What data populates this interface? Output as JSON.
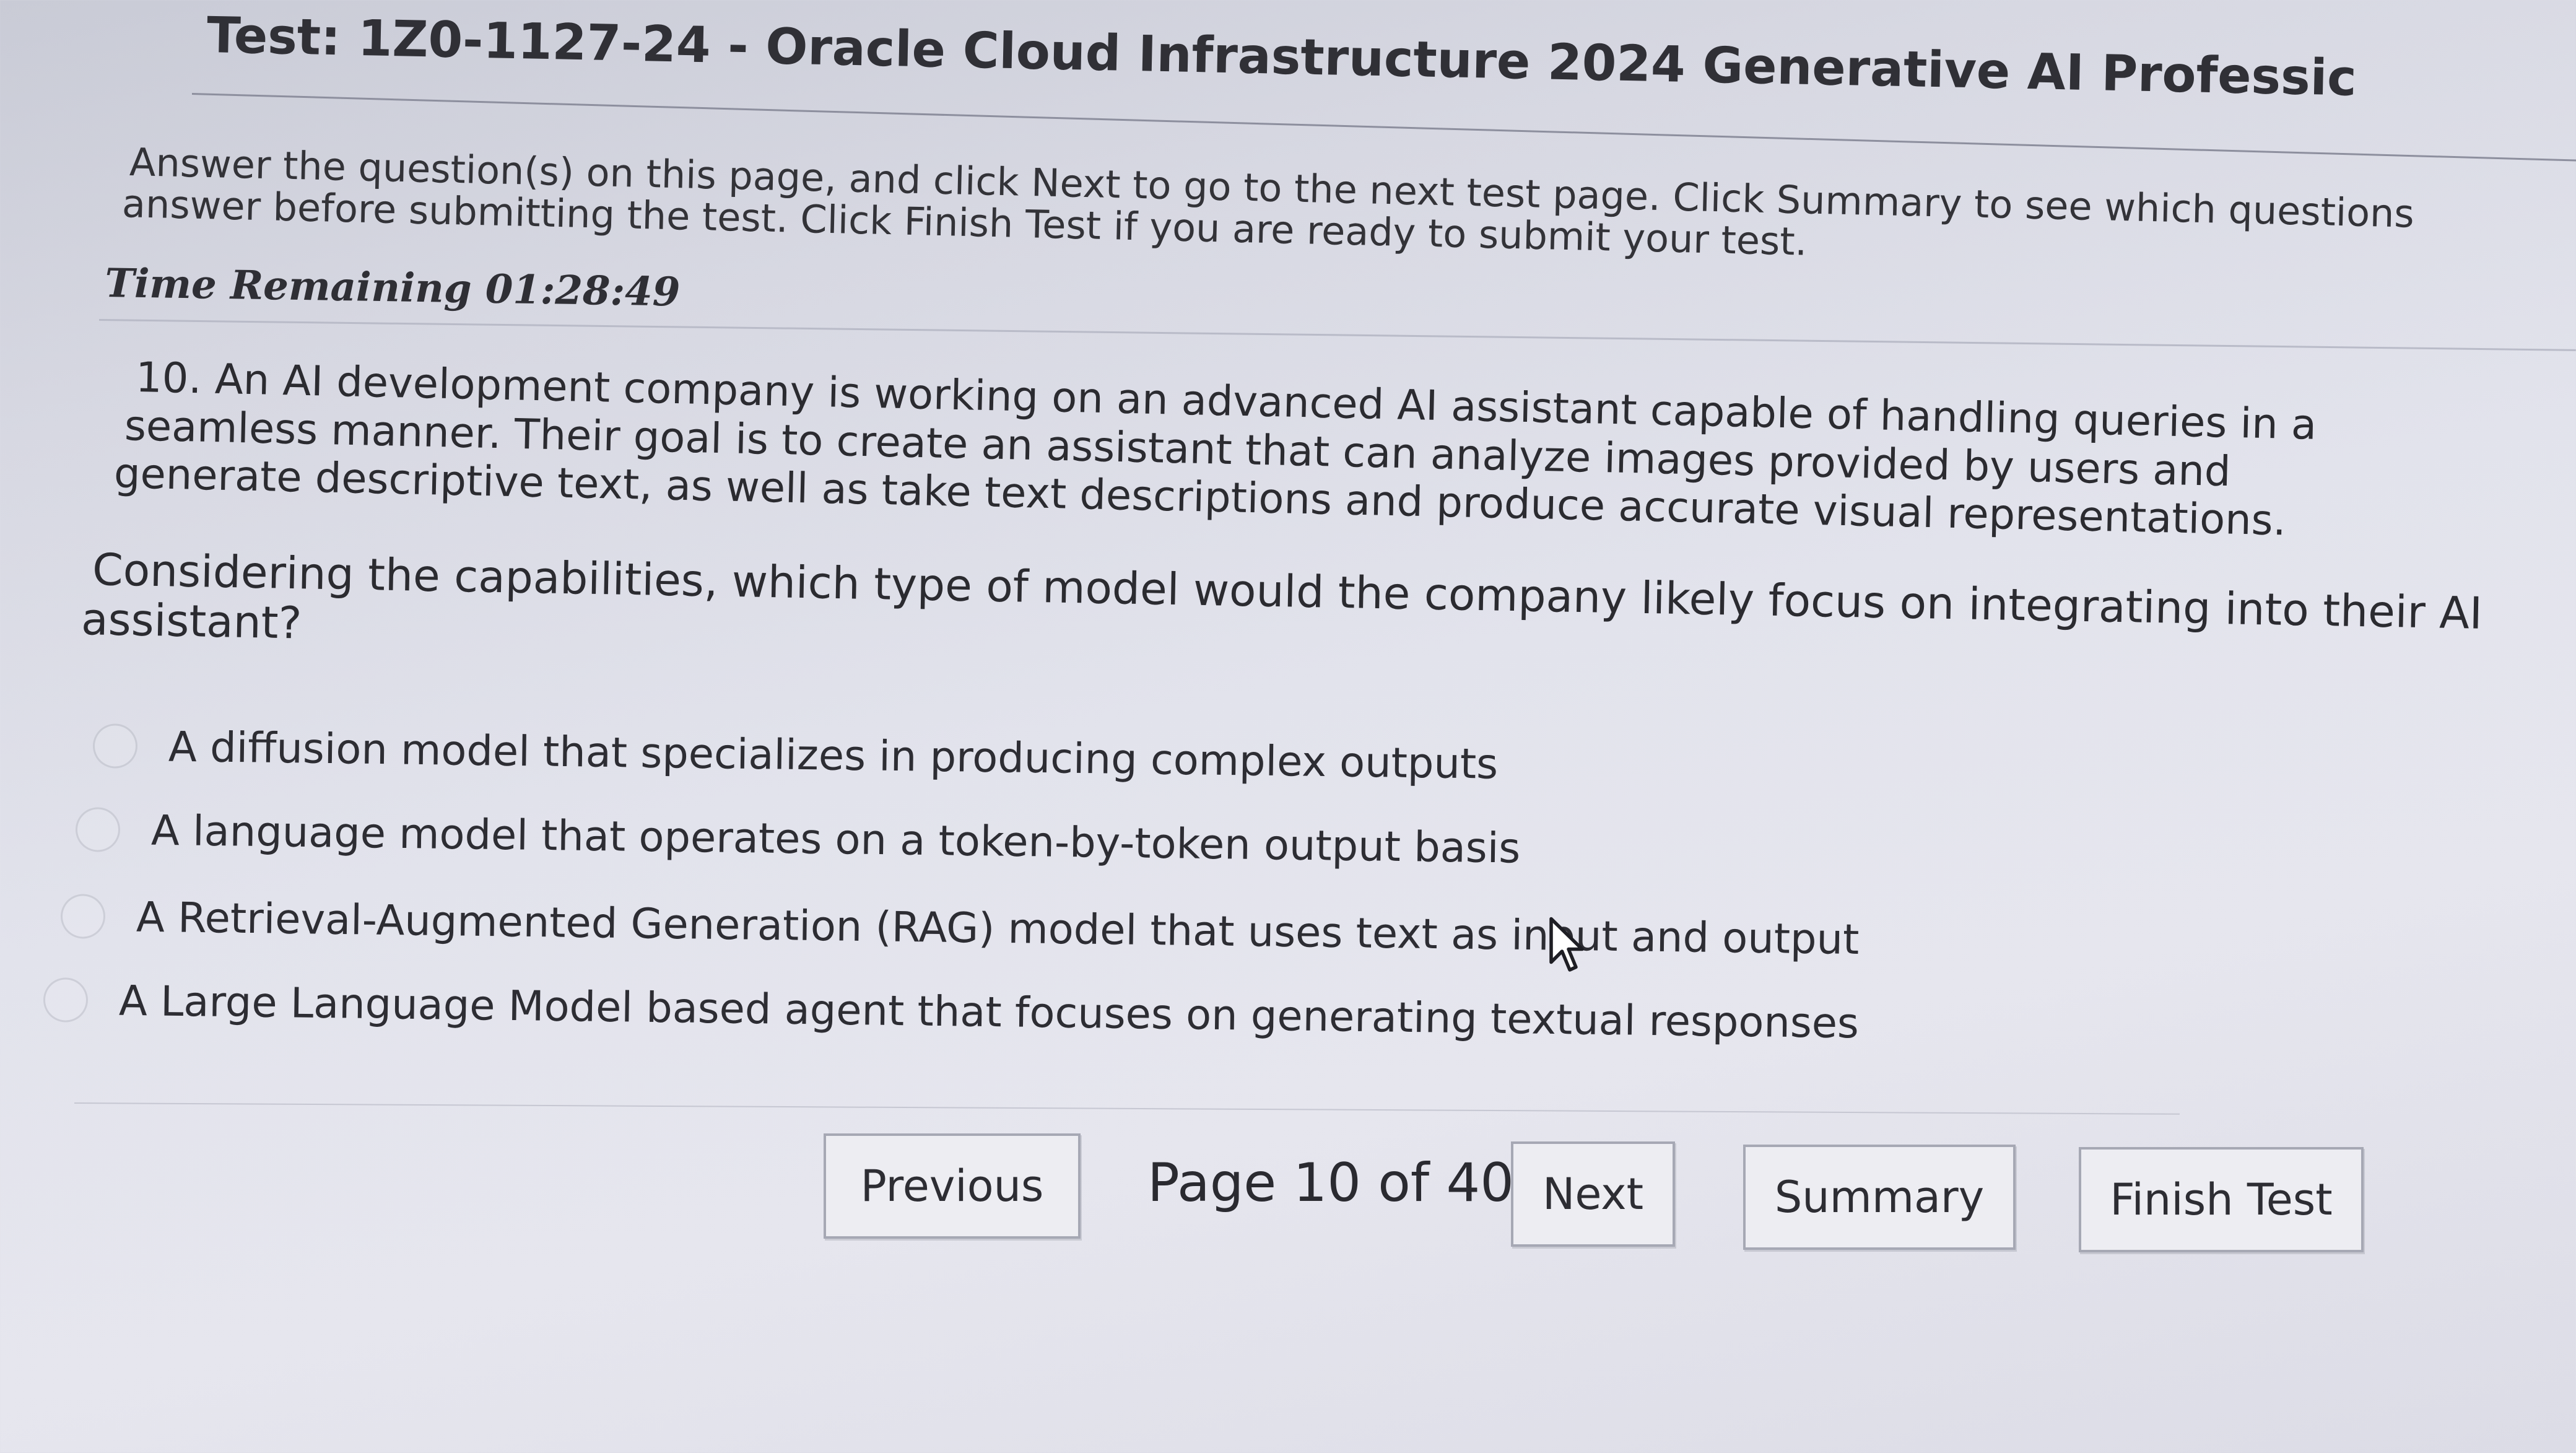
{
  "test": {
    "title": "Test: 1Z0-1127-24 - Oracle Cloud Infrastructure 2024 Generative AI Professic"
  },
  "instructions": {
    "line1": "Answer the question(s) on this page, and click Next to go to the next test page. Click Summary to see which questions",
    "line2": "answer before submitting the test. Click Finish Test if you are ready to submit your test."
  },
  "timer": {
    "text": "Time Remaining 01:28:49"
  },
  "question": {
    "line1": "10. An AI development company is working on an advanced AI assistant capable of handling queries in a",
    "line2": "seamless manner. Their goal is to create an assistant that can analyze images provided by users and",
    "line3": "generate descriptive text, as well as take text descriptions and produce accurate visual representations.",
    "prompt_line1": "Considering the capabilities, which type of model would the company likely focus on integrating into their AI",
    "prompt_line2": "assistant?"
  },
  "options": [
    {
      "label": "A diffusion model that specializes in producing complex outputs"
    },
    {
      "label": "A language model that operates on a token-by-token output basis"
    },
    {
      "label": "A Retrieval-Augmented Generation (RAG) model that uses text as input and output"
    },
    {
      "label": "A Large Language Model based agent that focuses on generating textual responses"
    }
  ],
  "navigation": {
    "previous_label": "Previous",
    "page_indicator": "Page 10 of 40",
    "next_label": "Next",
    "summary_label": "Summary",
    "finish_label": "Finish Test"
  },
  "icons": {
    "cursor": "mouse-pointer-icon"
  }
}
